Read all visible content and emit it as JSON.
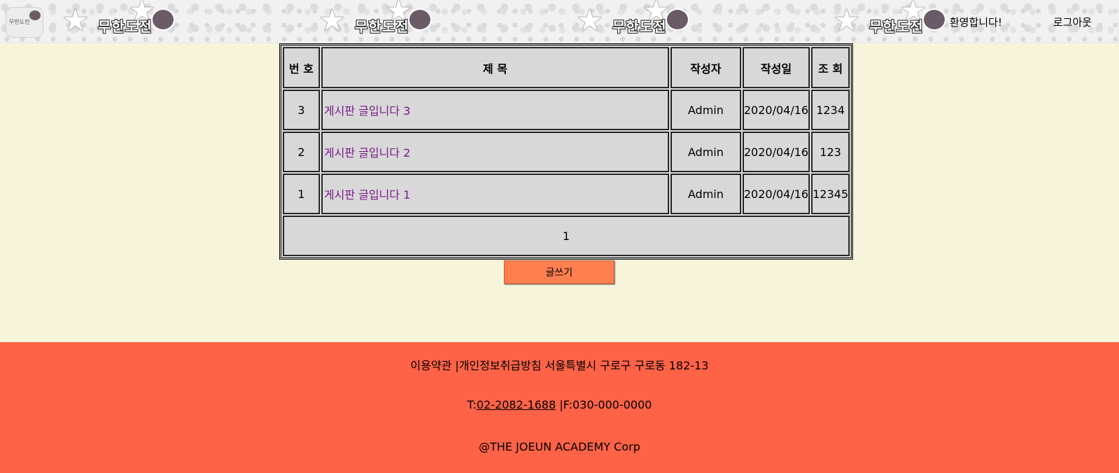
{
  "header": {
    "logo_text": "무한도전",
    "banner_text": "무한도전",
    "welcome": "환영합니다!",
    "logout": "로그아웃"
  },
  "board": {
    "columns": [
      "번 호",
      "제 목",
      "작성자",
      "작성일",
      "조 회"
    ],
    "rows": [
      {
        "no": "3",
        "title": "게시판 글입니다 3",
        "writer": "Admin",
        "date": "2020/04/16",
        "views": "1234"
      },
      {
        "no": "2",
        "title": "게시판 글입니다 2",
        "writer": "Admin",
        "date": "2020/04/16",
        "views": "123"
      },
      {
        "no": "1",
        "title": "게시판 글입니다 1",
        "writer": "Admin",
        "date": "2020/04/16",
        "views": "12345"
      }
    ],
    "page": "1"
  },
  "write_button": "글쓰기",
  "footer": {
    "line1": "이용약관 |개인정보취급방침 서울특별시 구로구 구로동 182-13",
    "phone_prefix": "T:",
    "phone": "02-2082-1688",
    "fax": " |F:030-000-0000",
    "copyright": "@THE JOEUN ACADEMY Corp"
  },
  "colors": {
    "background": "#f6f5dc",
    "footer": "#ff6347",
    "button": "#ff7f50",
    "link": "#7a1a8a",
    "table": "#d8d8d8"
  }
}
